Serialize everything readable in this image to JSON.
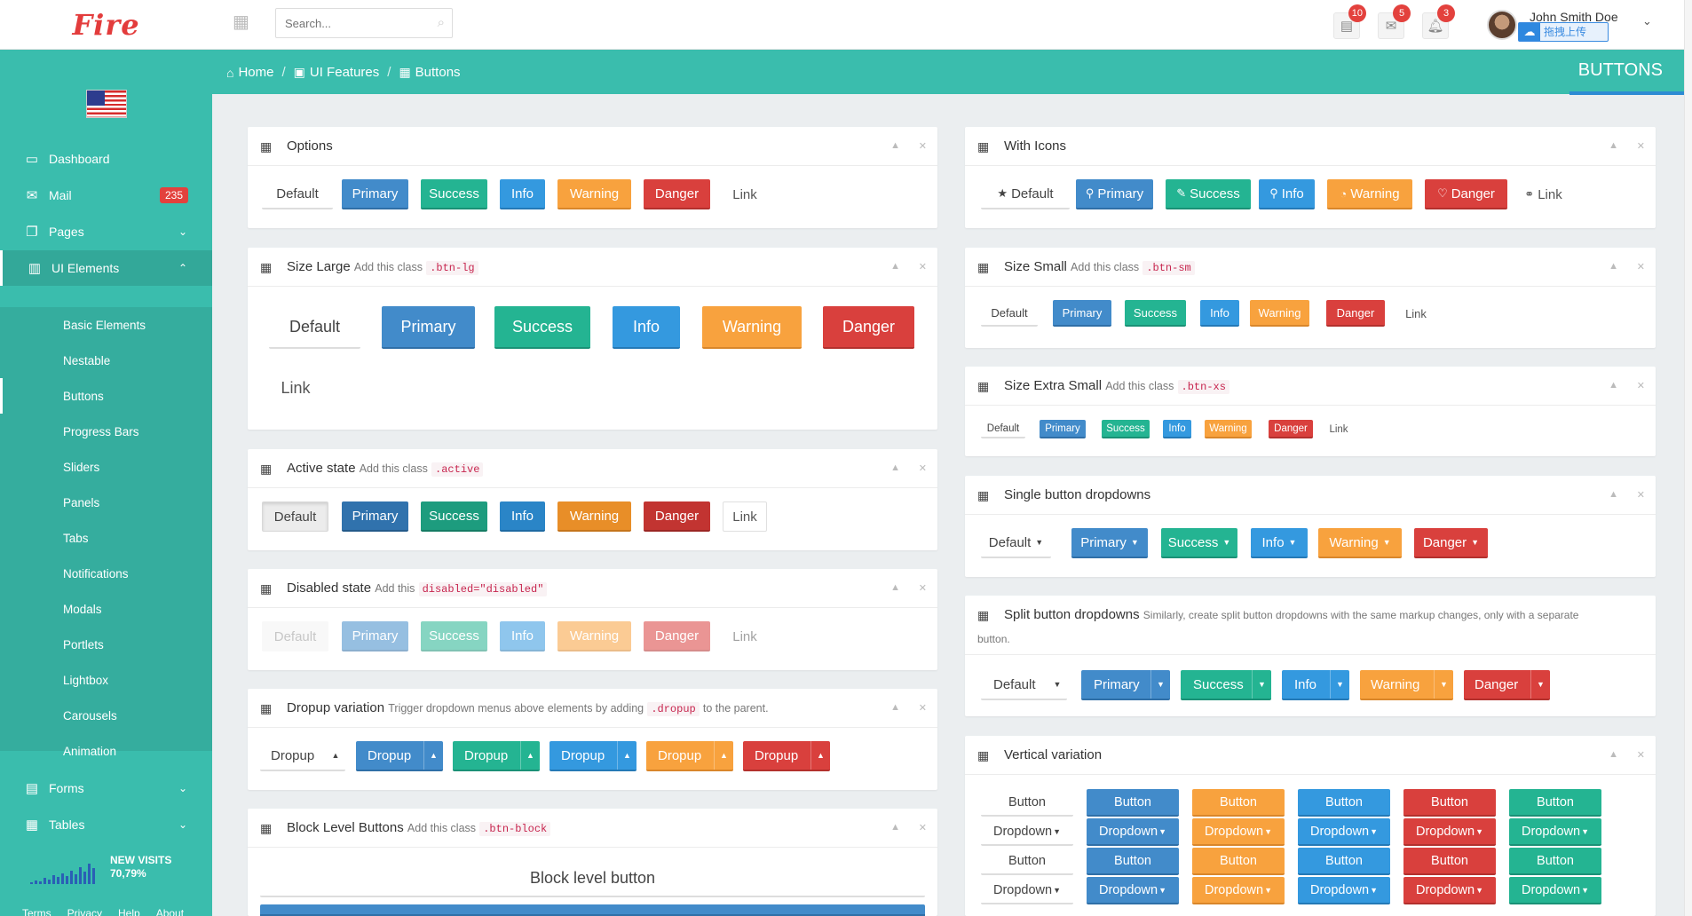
{
  "app": {
    "logo_text": "Fire"
  },
  "topbar": {
    "search_placeholder": "Search...",
    "notifications": [
      {
        "icon": "messages-icon",
        "glyph": "▤",
        "count": "10"
      },
      {
        "icon": "envelope-icon",
        "glyph": "✉",
        "count": "5"
      },
      {
        "icon": "bell-icon",
        "glyph": "♪",
        "count": "3"
      }
    ],
    "user_name": "John Smith Doe",
    "upload_label": "拖拽上传"
  },
  "sidebar": {
    "items": [
      {
        "label": "Dashboard",
        "icon": "laptop-icon"
      },
      {
        "label": "Mail",
        "icon": "envelope-icon",
        "badge": "235"
      },
      {
        "label": "Pages",
        "icon": "copy-icon"
      },
      {
        "label": "UI Elements",
        "icon": "columns-icon"
      },
      {
        "label": "Forms",
        "icon": "list-icon"
      },
      {
        "label": "Tables",
        "icon": "table-icon"
      }
    ],
    "sub_items": [
      "Basic Elements",
      "Nestable",
      "Buttons",
      "Progress Bars",
      "Sliders",
      "Panels",
      "Tabs",
      "Notifications",
      "Modals",
      "Portlets",
      "Lightbox",
      "Carousels",
      "Animation"
    ],
    "visits_label": "NEW VISITS",
    "visits_value": "70,79%",
    "visits_bars": [
      2,
      4,
      3,
      6,
      5,
      9,
      7,
      11,
      8,
      14,
      10,
      17,
      13,
      21,
      16
    ],
    "footer_links": [
      "Terms",
      "Privacy",
      "Help",
      "About"
    ]
  },
  "breadcrumb": {
    "items": [
      "Home",
      "UI Features",
      "Buttons"
    ],
    "page_title": "BUTTONS"
  },
  "buttons": {
    "default": "Default",
    "primary": "Primary",
    "success": "Success",
    "info": "Info",
    "warning": "Warning",
    "danger": "Danger",
    "link": "Link"
  },
  "panels": {
    "options": {
      "title": "Options"
    },
    "size_large": {
      "title": "Size Large",
      "sub": "Add this class",
      "code": ".btn-lg"
    },
    "active": {
      "title": "Active state",
      "sub": "Add this class",
      "code": ".active"
    },
    "disabled": {
      "title": "Disabled state",
      "sub": "Add this",
      "code": "disabled=\"disabled\""
    },
    "dropup": {
      "title": "Dropup variation",
      "sub": "Trigger dropdown menus above elements by adding",
      "code": ".dropup",
      "sub2": "to the parent.",
      "button": "Dropup"
    },
    "block": {
      "title": "Block Level Buttons",
      "sub": "Add this class",
      "code": ".btn-block",
      "button": "Block level button"
    },
    "icons": {
      "title": "With Icons"
    },
    "size_small": {
      "title": "Size Small",
      "sub": "Add this class",
      "code": ".btn-sm"
    },
    "size_xs": {
      "title": "Size Extra Small",
      "sub": "Add this class",
      "code": ".btn-xs"
    },
    "single_dd": {
      "title": "Single button dropdowns"
    },
    "split_dd": {
      "title": "Split button dropdowns",
      "sub": "Similarly, create split button dropdowns with the same markup changes, only with a separate",
      "sub_line2": "button."
    },
    "vertical": {
      "title": "Vertical variation",
      "button": "Button",
      "dropdown": "Dropdown"
    }
  }
}
